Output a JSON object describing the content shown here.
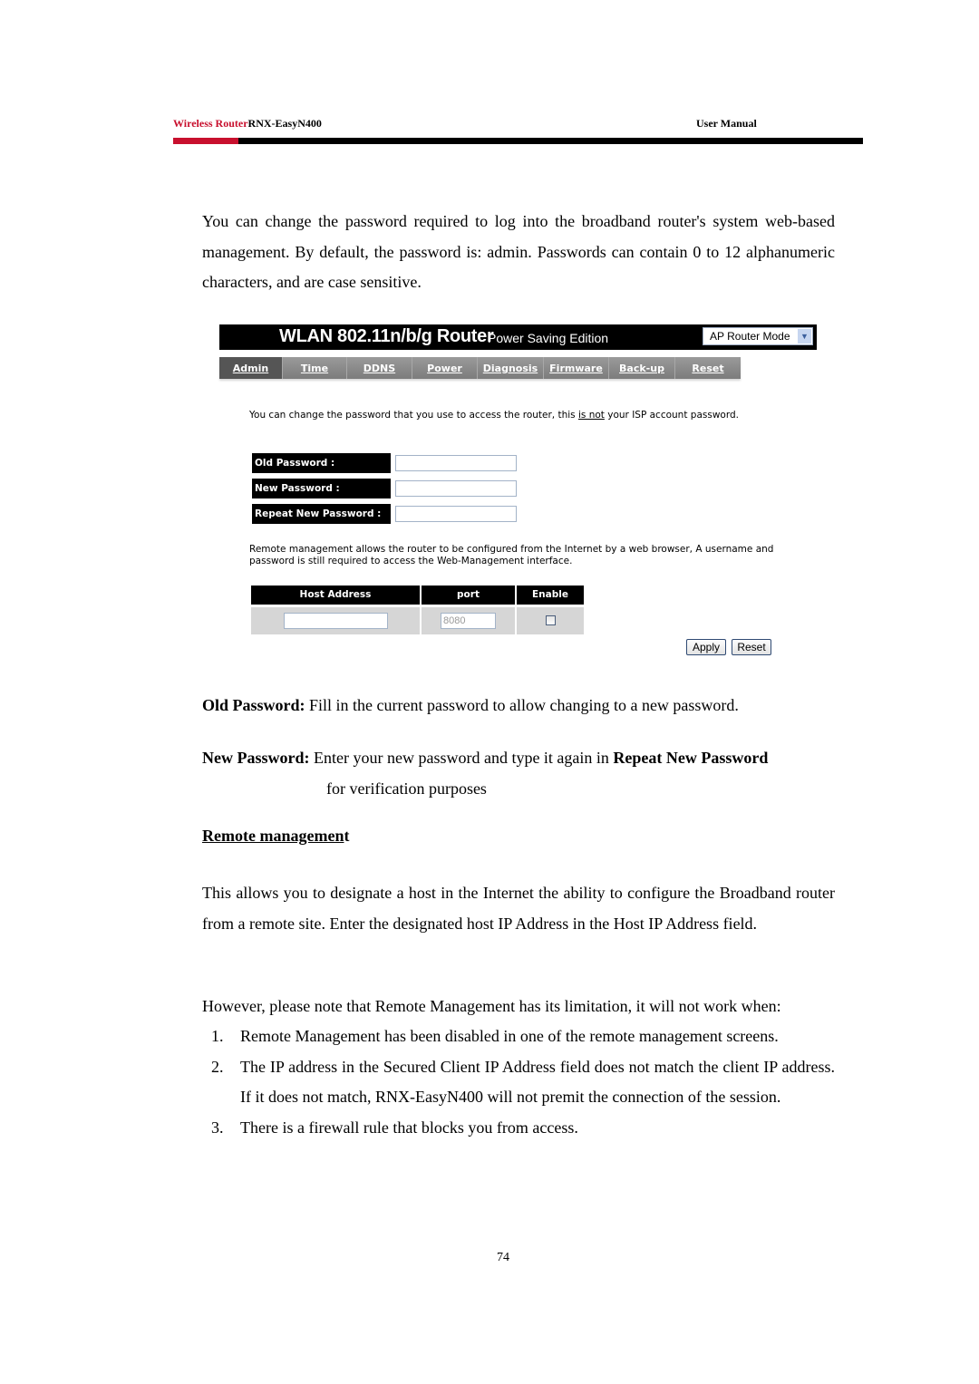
{
  "header": {
    "brand_red": "Wireless Router",
    "model": "RNX-EasyN400",
    "doc_type": "User Manual",
    "accent_color": "#c8102e"
  },
  "intro_paragraph": "You can change the password required to log into the broadband router's system web-based management. By default, the password is: admin. Passwords can contain 0 to 12 alphanumeric characters, and are case sensitive.",
  "router_ui": {
    "banner_title": "WLAN 802.11n/b/g Router",
    "banner_subtitle": "Power Saving Edition",
    "mode_select": {
      "value": "AP Router Mode",
      "arrow_icon": "chevron-down-icon"
    },
    "nav_tabs": [
      {
        "label": "Admin",
        "active": true
      },
      {
        "label": "Time",
        "active": false
      },
      {
        "label": "DDNS",
        "active": false
      },
      {
        "label": "Power",
        "active": false
      },
      {
        "label": "Diagnosis",
        "active": false
      },
      {
        "label": "Firmware",
        "active": false
      },
      {
        "label": "Back-up",
        "active": false
      },
      {
        "label": "Reset",
        "active": false
      }
    ],
    "intro_before": "You can change the password that you use to access the router, this ",
    "intro_emph": "is not",
    "intro_after": " your ISP account password.",
    "password_fields": [
      {
        "label": "Old Password :",
        "value": ""
      },
      {
        "label": "New Password :",
        "value": ""
      },
      {
        "label": "Repeat New Password :",
        "value": ""
      }
    ],
    "remote_text": "Remote management allows the router to be configured from the Internet by a web browser, A username and password is still required to access the Web-Management interface.",
    "remote_table": {
      "headers": [
        "Host Address",
        "port",
        "Enable"
      ],
      "host_value": "",
      "port_value": "8080",
      "enabled": false
    },
    "apply_label": "Apply",
    "reset_label": "Reset"
  },
  "old_password": {
    "term": "Old Password:",
    "desc": " Fill in the current password to allow changing to a new password."
  },
  "new_password": {
    "term": "New Password:",
    "desc_before": " Enter your new password and type it again in ",
    "desc_emph": "Repeat New Password",
    "desc_cont": "for verification purposes"
  },
  "remote_section": {
    "title_underlined": "Remote managemen",
    "title_rest": "t",
    "paragraph": "This allows you to designate a host in the Internet the ability to configure the Broadband router from a remote site. Enter the designated host IP Address in the Host IP Address field.",
    "however": "However, please note that Remote Management has its limitation, it will not work when:",
    "conditions": [
      {
        "num": "1.",
        "text": "Remote Management has been disabled in one of the remote management screens."
      },
      {
        "num": "2.",
        "text": "The IP address in the Secured Client IP Address field does not match the client IP address. If it does not match, RNX-EasyN400 will not premit the connection of the session."
      },
      {
        "num": "3.",
        "text": "There is a firewall rule that blocks you from access."
      }
    ]
  },
  "page_number": "74"
}
